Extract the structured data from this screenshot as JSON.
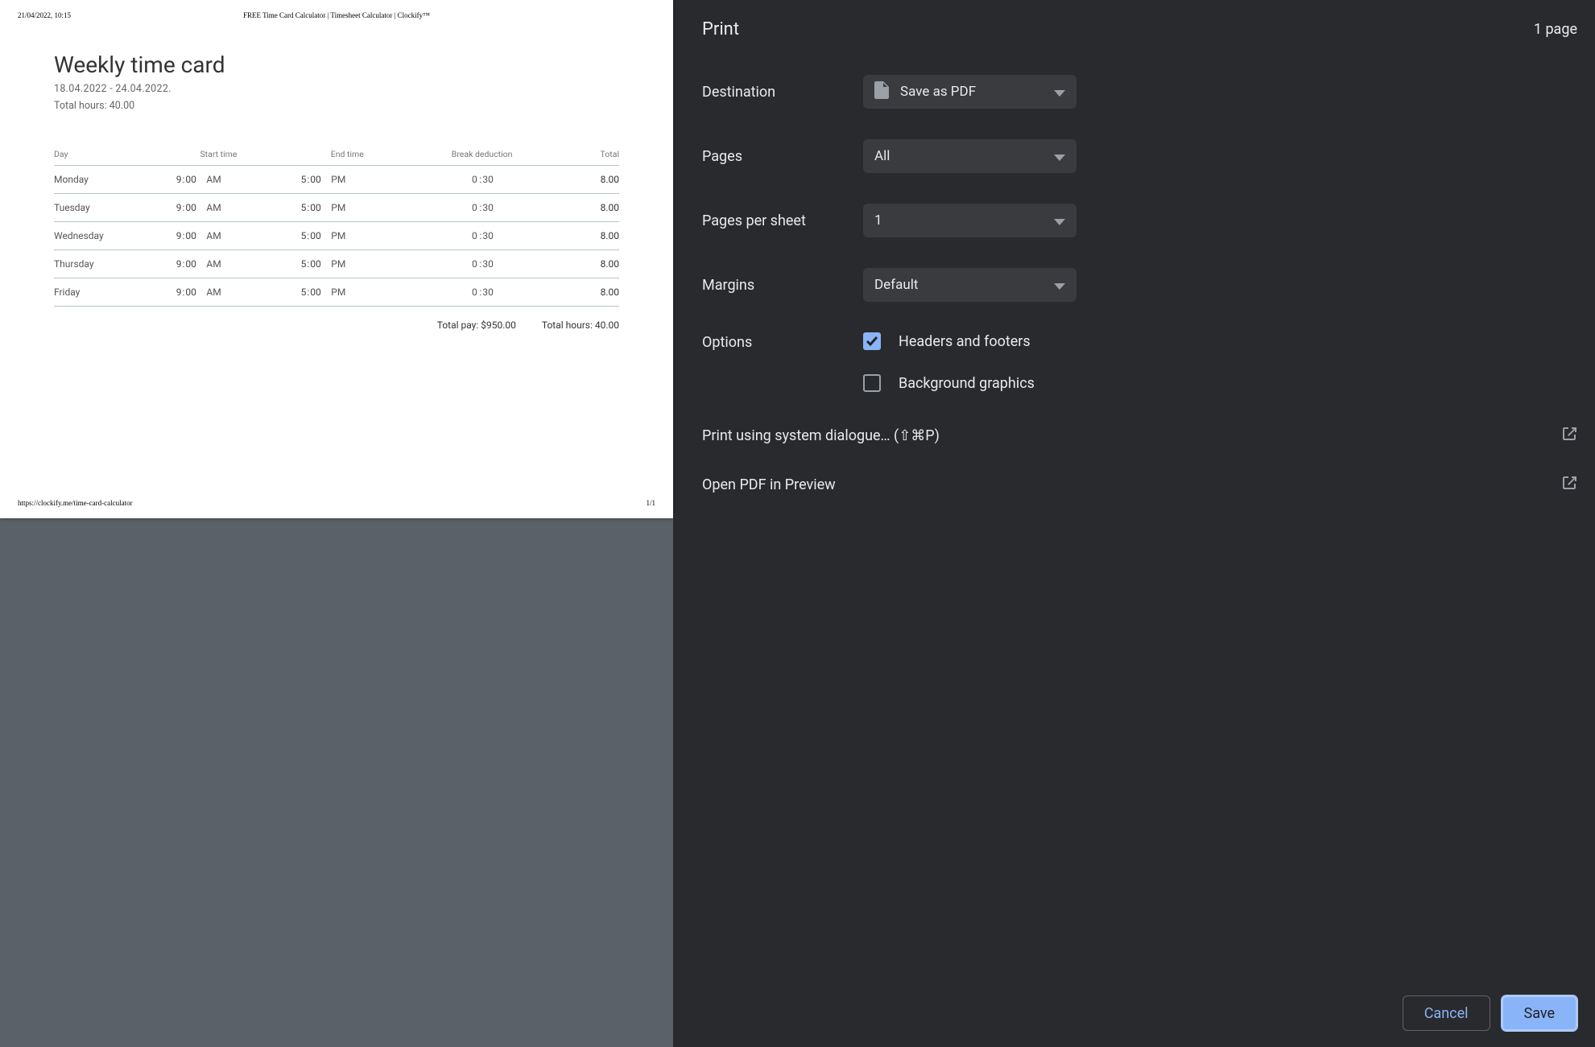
{
  "preview": {
    "header_left": "21/04/2022, 10:15",
    "header_center": "FREE Time Card Calculator | Timesheet Calculator | Clockify™",
    "footer_left": "https://clockify.me/time-card-calculator",
    "footer_right": "1/1"
  },
  "timecard": {
    "title": "Weekly time card",
    "date_range": "18.04.2022 - 24.04.2022.",
    "total_hours_top": "Total hours: 40.00",
    "columns": {
      "day": "Day",
      "start": "Start time",
      "end": "End time",
      "break": "Break deduction",
      "total": "Total"
    },
    "rows": [
      {
        "day": "Monday",
        "start_h": "9",
        "start_m": "00",
        "start_ampm": "AM",
        "end_h": "5",
        "end_m": "00",
        "end_ampm": "PM",
        "break_h": "0",
        "break_m": "30",
        "total": "8.00"
      },
      {
        "day": "Tuesday",
        "start_h": "9",
        "start_m": "00",
        "start_ampm": "AM",
        "end_h": "5",
        "end_m": "00",
        "end_ampm": "PM",
        "break_h": "0",
        "break_m": "30",
        "total": "8.00"
      },
      {
        "day": "Wednesday",
        "start_h": "9",
        "start_m": "00",
        "start_ampm": "AM",
        "end_h": "5",
        "end_m": "00",
        "end_ampm": "PM",
        "break_h": "0",
        "break_m": "30",
        "total": "8.00"
      },
      {
        "day": "Thursday",
        "start_h": "9",
        "start_m": "00",
        "start_ampm": "AM",
        "end_h": "5",
        "end_m": "00",
        "end_ampm": "PM",
        "break_h": "0",
        "break_m": "30",
        "total": "8.00"
      },
      {
        "day": "Friday",
        "start_h": "9",
        "start_m": "00",
        "start_ampm": "AM",
        "end_h": "5",
        "end_m": "00",
        "end_ampm": "PM",
        "break_h": "0",
        "break_m": "30",
        "total": "8.00"
      }
    ],
    "summary": {
      "total_pay": "Total pay: $950.00",
      "total_hours": "Total hours: 40.00"
    }
  },
  "panel": {
    "title": "Print",
    "page_count": "1 page",
    "settings": {
      "destination_label": "Destination",
      "destination_value": "Save as PDF",
      "pages_label": "Pages",
      "pages_value": "All",
      "pps_label": "Pages per sheet",
      "pps_value": "1",
      "margins_label": "Margins",
      "margins_value": "Default",
      "options_label": "Options",
      "headers_label": "Headers and footers",
      "bg_label": "Background graphics"
    },
    "links": {
      "system_dialog": "Print using system dialogue… (⇧⌘P)",
      "open_preview": "Open PDF in Preview"
    },
    "buttons": {
      "cancel": "Cancel",
      "save": "Save"
    }
  }
}
